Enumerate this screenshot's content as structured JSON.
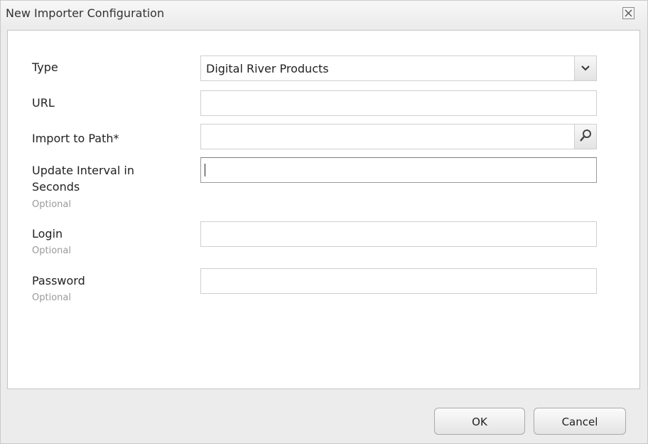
{
  "dialog": {
    "title": "New Importer Configuration",
    "close_icon": "close-icon"
  },
  "form": {
    "type": {
      "label": "Type",
      "value": "Digital River Products",
      "icon": "chevron-down-icon"
    },
    "url": {
      "label": "URL",
      "value": ""
    },
    "import_path": {
      "label": "Import to Path*",
      "value": "",
      "icon": "search-icon"
    },
    "update_interval": {
      "label_line1": "Update Interval in",
      "label_line2": "Seconds",
      "hint": "Optional",
      "value": ""
    },
    "login": {
      "label": "Login",
      "hint": "Optional",
      "value": ""
    },
    "password": {
      "label": "Password",
      "hint": "Optional",
      "value": ""
    }
  },
  "footer": {
    "ok_label": "OK",
    "cancel_label": "Cancel"
  }
}
